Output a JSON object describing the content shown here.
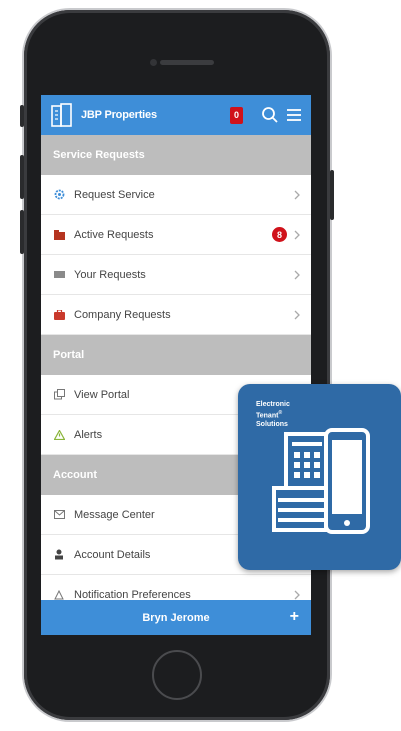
{
  "app": {
    "title": "JBP Properties",
    "notification_count": "0"
  },
  "sections": [
    {
      "header": "Service Requests",
      "items": [
        {
          "label": "Request Service",
          "icon": "gear-icon",
          "chevron": true
        },
        {
          "label": "Active Requests",
          "icon": "folder-icon",
          "badge": "8",
          "chevron": true
        },
        {
          "label": "Your Requests",
          "icon": "inbox-icon",
          "chevron": true
        },
        {
          "label": "Company Requests",
          "icon": "briefcase-icon",
          "chevron": true
        }
      ]
    },
    {
      "header": "Portal",
      "items": [
        {
          "label": "View Portal",
          "icon": "portal-icon"
        },
        {
          "label": "Alerts",
          "icon": "warning-icon"
        }
      ]
    },
    {
      "header": "Account",
      "items": [
        {
          "label": "Message Center",
          "icon": "envelope-icon"
        },
        {
          "label": "Account Details",
          "icon": "user-icon"
        },
        {
          "label": "Notification Preferences",
          "icon": "bell-icon",
          "chevron": true
        }
      ]
    }
  ],
  "footer": {
    "user_name": "Bryn Jerome",
    "plus": "+"
  },
  "ets": {
    "line1": "Electronic",
    "line2": "Tenant",
    "tm": "®",
    "line3": "Solutions"
  },
  "colors": {
    "brand_blue": "#3e8ed8",
    "card_blue": "#2f6aa6",
    "badge_red": "#d0121b",
    "section_gray": "#bdbdbd"
  }
}
